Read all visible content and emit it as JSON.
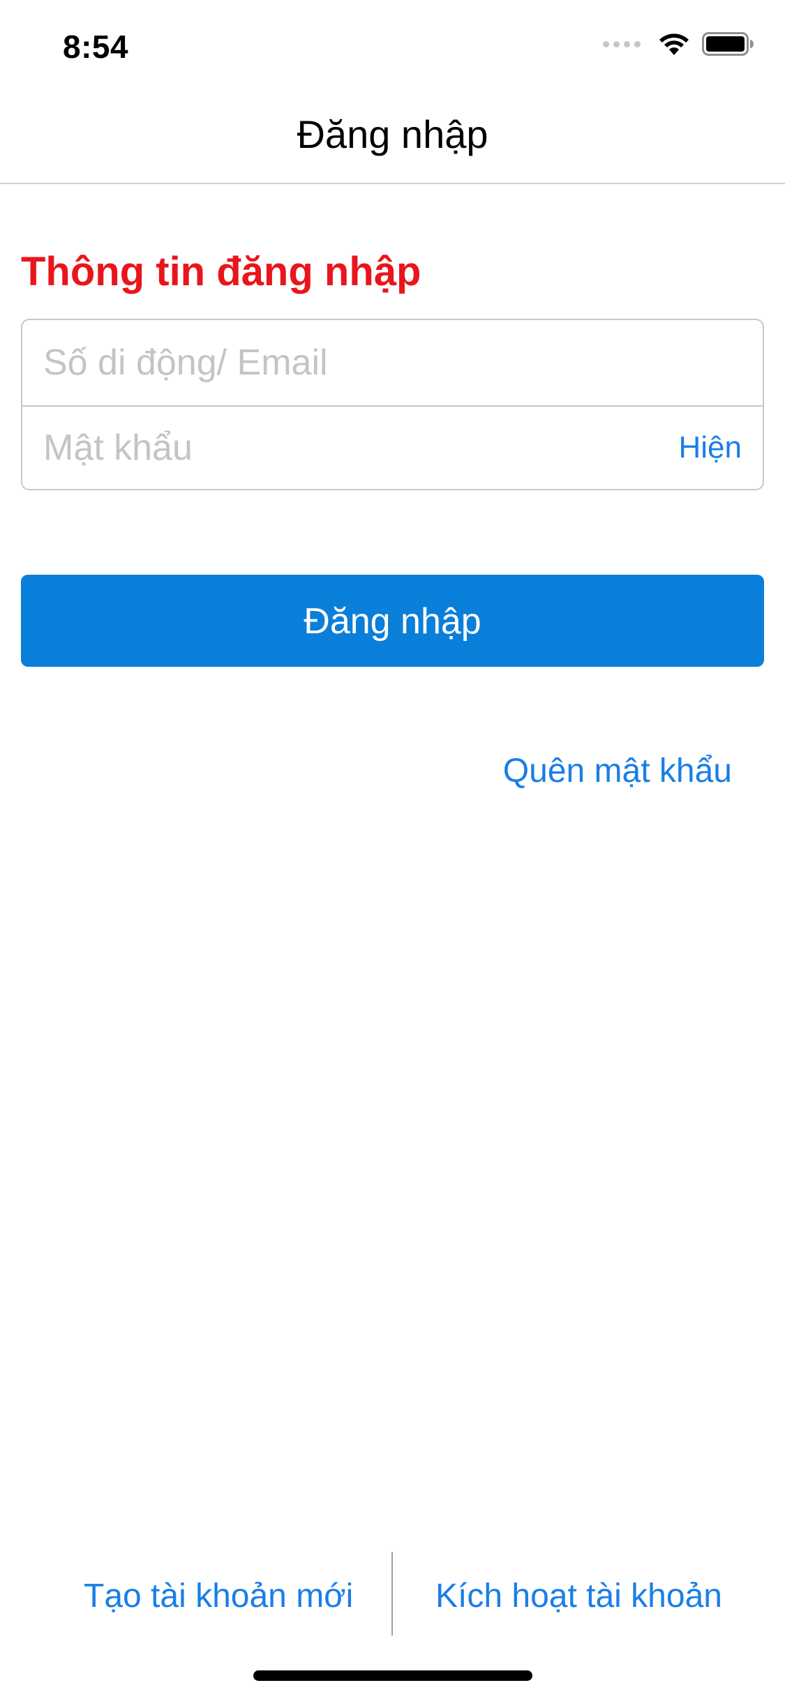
{
  "status_bar": {
    "time": "8:54",
    "icons": [
      "cellular-signal-icon",
      "wifi-icon",
      "battery-icon"
    ]
  },
  "nav": {
    "title": "Đăng nhập"
  },
  "section": {
    "title": "Thông tin đăng nhập"
  },
  "form": {
    "username_placeholder": "Số di động/ Email",
    "username_value": "",
    "password_placeholder": "Mật khẩu",
    "password_value": "",
    "show_password_label": "Hiện"
  },
  "actions": {
    "login_label": "Đăng nhập",
    "forgot_password_label": "Quên mật khẩu"
  },
  "footer": {
    "create_account_label": "Tạo tài khoản mới",
    "activate_account_label": "Kích hoạt tài khoản"
  },
  "colors": {
    "accent": "#0a7fd9",
    "link": "#1a7ee6",
    "section_title": "#e8161c"
  }
}
